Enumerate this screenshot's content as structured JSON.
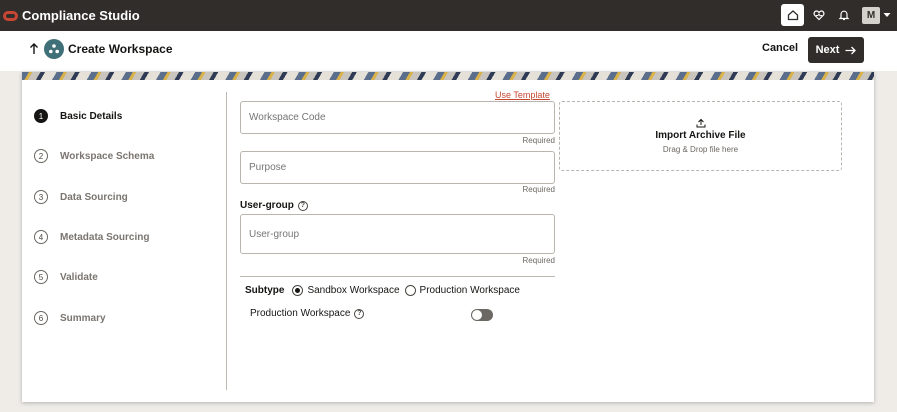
{
  "app": {
    "title": "Compliance Studio",
    "user_initial": "M"
  },
  "header": {
    "title": "Create Workspace",
    "cancel_label": "Cancel",
    "next_label": "Next"
  },
  "steps": [
    {
      "num": "1",
      "label": "Basic Details",
      "active": true
    },
    {
      "num": "2",
      "label": "Workspace Schema",
      "active": false
    },
    {
      "num": "3",
      "label": "Data Sourcing",
      "active": false
    },
    {
      "num": "4",
      "label": "Metadata Sourcing",
      "active": false
    },
    {
      "num": "5",
      "label": "Validate",
      "active": false
    },
    {
      "num": "6",
      "label": "Summary",
      "active": false
    }
  ],
  "form": {
    "use_template": "Use Template",
    "workspace_code": {
      "placeholder": "Workspace Code",
      "required": "Required"
    },
    "purpose": {
      "placeholder": "Purpose",
      "required": "Required"
    },
    "user_group": {
      "label": "User-group",
      "placeholder": "User-group",
      "required": "Required"
    },
    "subtype": {
      "label": "Subtype",
      "options": [
        "Sandbox Workspace",
        "Production Workspace"
      ],
      "selected": "Sandbox Workspace"
    },
    "production_workspace": {
      "label": "Production Workspace",
      "enabled": false
    }
  },
  "import": {
    "title": "Import Archive File",
    "subtitle": "Drag & Drop file here"
  },
  "colors": {
    "topbar": "#312d2a",
    "accent": "#c74634",
    "primary_button": "#312d2a"
  }
}
